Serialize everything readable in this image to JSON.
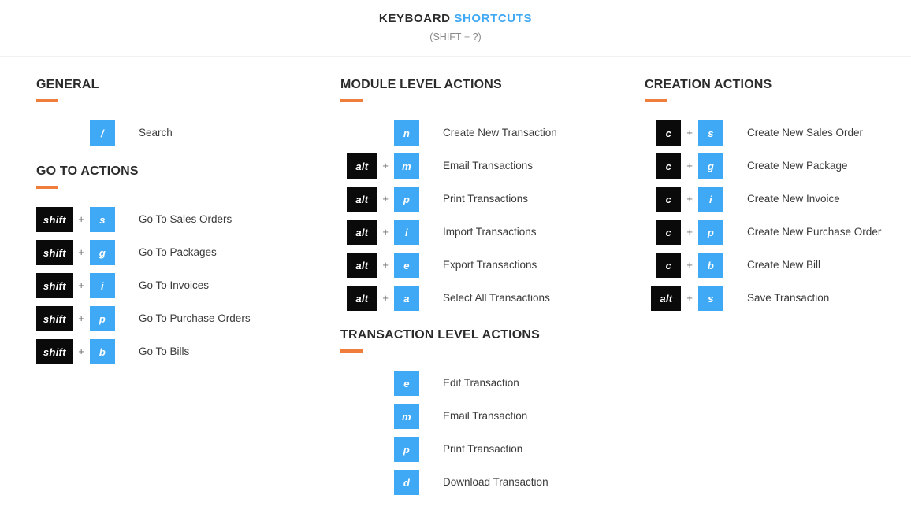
{
  "header": {
    "title_primary": "KEYBOARD",
    "title_accent": "SHORTCUTS",
    "subtitle": "(SHIFT + ?)"
  },
  "theme": {
    "accent_blue": "#3fa9f5",
    "accent_orange": "#ef7e3d",
    "key_dark": "#0a0a0a",
    "text": "#3a3a3a",
    "muted": "#8a8a8a"
  },
  "plus_symbol": "+",
  "columns": [
    {
      "id": "column-left",
      "sections": [
        {
          "id": "general",
          "title": "GENERAL",
          "rows": [
            {
              "mod": "",
              "key": "/",
              "label": "Search"
            }
          ]
        },
        {
          "id": "go-to-actions",
          "title": "GO TO ACTIONS",
          "rows": [
            {
              "mod": "shift",
              "key": "s",
              "label": "Go To Sales Orders"
            },
            {
              "mod": "shift",
              "key": "g",
              "label": "Go To Packages"
            },
            {
              "mod": "shift",
              "key": "i",
              "label": "Go To Invoices"
            },
            {
              "mod": "shift",
              "key": "p",
              "label": "Go To Purchase Orders"
            },
            {
              "mod": "shift",
              "key": "b",
              "label": "Go To Bills"
            }
          ]
        }
      ]
    },
    {
      "id": "column-middle",
      "sections": [
        {
          "id": "module-level-actions",
          "title": "MODULE LEVEL ACTIONS",
          "rows": [
            {
              "mod": "",
              "key": "n",
              "label": "Create New Transaction"
            },
            {
              "mod": "alt",
              "key": "m",
              "label": "Email Transactions"
            },
            {
              "mod": "alt",
              "key": "p",
              "label": "Print Transactions"
            },
            {
              "mod": "alt",
              "key": "i",
              "label": "Import Transactions"
            },
            {
              "mod": "alt",
              "key": "e",
              "label": "Export Transactions"
            },
            {
              "mod": "alt",
              "key": "a",
              "label": "Select All Transactions"
            }
          ]
        },
        {
          "id": "transaction-level-actions",
          "title": "TRANSACTION LEVEL ACTIONS",
          "rows": [
            {
              "mod": "",
              "key": "e",
              "label": "Edit Transaction"
            },
            {
              "mod": "",
              "key": "m",
              "label": "Email Transaction"
            },
            {
              "mod": "",
              "key": "p",
              "label": "Print Transaction"
            },
            {
              "mod": "",
              "key": "d",
              "label": "Download Transaction"
            }
          ]
        }
      ]
    },
    {
      "id": "column-right",
      "sections": [
        {
          "id": "creation-actions",
          "title": "CREATION ACTIONS",
          "rows": [
            {
              "mod": "c",
              "key": "s",
              "label": "Create New Sales Order"
            },
            {
              "mod": "c",
              "key": "g",
              "label": "Create New Package"
            },
            {
              "mod": "c",
              "key": "i",
              "label": "Create New Invoice"
            },
            {
              "mod": "c",
              "key": "p",
              "label": "Create New Purchase Order"
            },
            {
              "mod": "c",
              "key": "b",
              "label": "Create New Bill"
            },
            {
              "mod": "alt",
              "key": "s",
              "label": "Save Transaction"
            }
          ]
        }
      ]
    }
  ]
}
